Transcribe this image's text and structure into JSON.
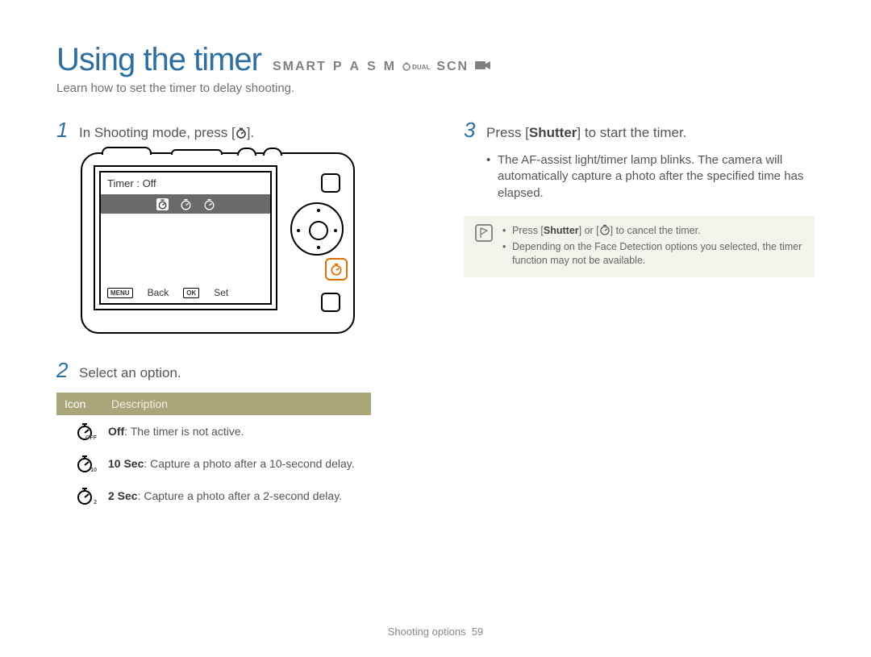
{
  "header": {
    "title": "Using the timer",
    "modes": [
      "SMART",
      "P",
      "A",
      "S",
      "M",
      "DUAL",
      "SCN"
    ]
  },
  "intro": "Learn how to set the timer to delay shooting.",
  "steps": {
    "s1_num": "1",
    "s1_text_a": "In Shooting mode, press [",
    "s1_text_b": "].",
    "s2_num": "2",
    "s2_text": "Select an option.",
    "s3_num": "3",
    "s3_text_a": "Press [",
    "s3_text_bold": "Shutter",
    "s3_text_b": "] to start the timer."
  },
  "camera_lcd": {
    "title": "Timer : Off",
    "back_key": "MENU",
    "back_label": "Back",
    "set_key": "OK",
    "set_label": "Set"
  },
  "options_table": {
    "head_icon": "Icon",
    "head_desc": "Description",
    "rows": [
      {
        "sub": "OFF",
        "bold": "Off",
        "rest": ": The timer is not active."
      },
      {
        "sub": "10",
        "bold": "10 Sec",
        "rest": ": Capture a photo after a 10-second delay."
      },
      {
        "sub": "2",
        "bold": "2 Sec",
        "rest": ": Capture a photo after a 2-second delay."
      }
    ]
  },
  "right_bullets": {
    "b1": "The AF-assist light/timer lamp blinks. The camera will automatically capture a photo after the specified time has elapsed."
  },
  "note": {
    "n1_a": "Press [",
    "n1_bold": "Shutter",
    "n1_b": "] or [",
    "n1_c": "] to cancel the timer.",
    "n2": "Depending on the Face Detection options you selected, the timer function may not be available."
  },
  "footer": {
    "section": "Shooting options",
    "page": "59"
  }
}
